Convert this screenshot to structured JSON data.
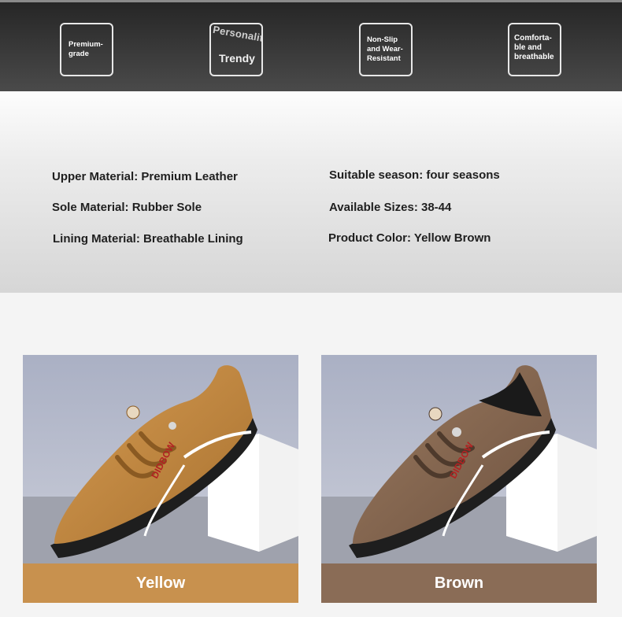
{
  "features": [
    {
      "text": "Premium-grade"
    },
    {
      "arc": "Personality",
      "text": "Trendy"
    },
    {
      "text": "Non-Slip and Wear-Resistant"
    },
    {
      "text": "Comforta-ble and breathable"
    }
  ],
  "specs": {
    "upper": "Upper Material: Premium Leather",
    "sole": "Sole Material: Rubber Sole",
    "lining": "Lining Material: Breathable Lining",
    "season": "Suitable season: four seasons",
    "sizes": "Available Sizes: 38-44",
    "color": "Product Color: Yellow Brown"
  },
  "products": [
    {
      "label": "Yellow",
      "brand_print": "DIDBOW",
      "color": "#c8914e",
      "shoe_color": "#c08a45"
    },
    {
      "label": "Brown",
      "brand_print": "DIDBOW",
      "color": "#8a6c56",
      "shoe_color": "#8c6e55"
    }
  ]
}
